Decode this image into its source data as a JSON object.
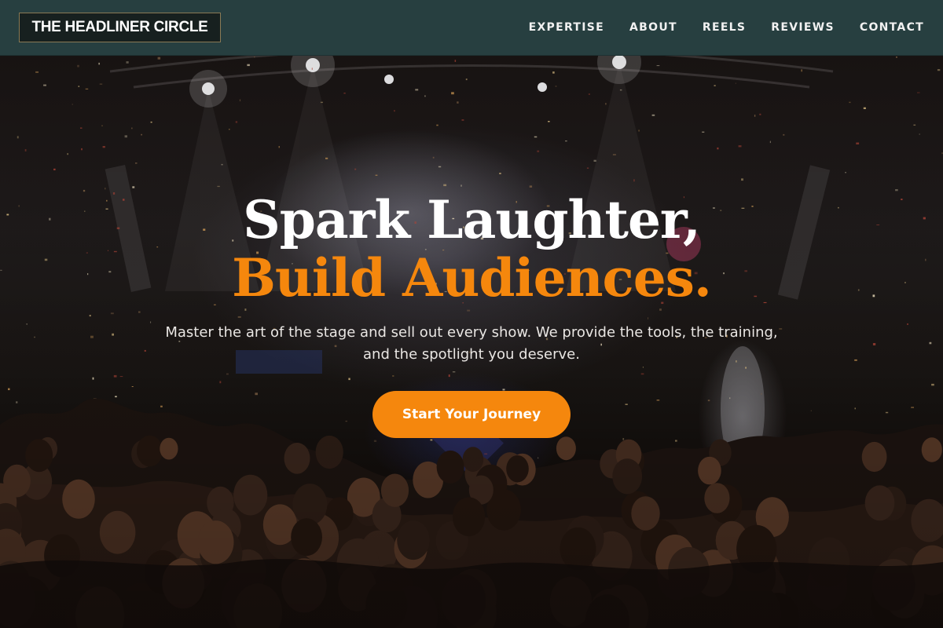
{
  "header": {
    "logo_text": "THE HEADLINER CIRCLE",
    "nav": [
      {
        "label": "EXPERTISE"
      },
      {
        "label": "ABOUT"
      },
      {
        "label": "REELS"
      },
      {
        "label": "REVIEWS"
      },
      {
        "label": "CONTACT"
      }
    ]
  },
  "hero": {
    "headline_line1": "Spark Laughter,",
    "headline_line2": "Build Audiences.",
    "subtitle_line1": "Master the art of the stage and sell out every show. We provide the tools, the training,",
    "subtitle_line2": "and the spotlight you deserve.",
    "cta_label": "Start Your Journey",
    "background_image": "concert-crowd-stage-with-confetti"
  },
  "colors": {
    "header_bg": "#273f40",
    "accent": "#f5870d",
    "text_light": "#ffffff"
  }
}
